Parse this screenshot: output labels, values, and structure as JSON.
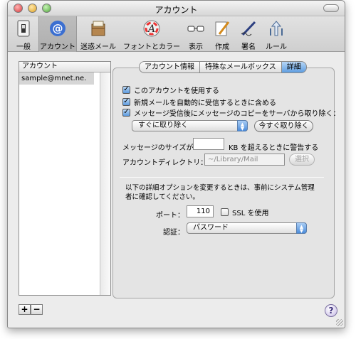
{
  "window": {
    "title": "アカウント"
  },
  "toolbar": {
    "items": [
      {
        "label": "一般",
        "icon": "light-switch-icon"
      },
      {
        "label": "アカウント",
        "icon": "at-sign-icon"
      },
      {
        "label": "迷惑メール",
        "icon": "junk-mail-icon"
      },
      {
        "label": "フォントとカラー",
        "icon": "font-color-icon"
      },
      {
        "label": "表示",
        "icon": "glasses-icon"
      },
      {
        "label": "作成",
        "icon": "compose-pencil-icon"
      },
      {
        "label": "署名",
        "icon": "signature-pen-icon"
      },
      {
        "label": "ルール",
        "icon": "rules-arrows-icon"
      }
    ]
  },
  "sidebar": {
    "header": "アカウント",
    "accounts": [
      "sample@mnet.ne."
    ]
  },
  "buttons": {
    "add": "+",
    "remove": "−",
    "help": "?"
  },
  "tabs": [
    "アカウント情報",
    "特殊なメールボックス",
    "詳細"
  ],
  "advanced": {
    "checkbox_use_account": "このアカウントを使用する",
    "checkbox_auto_receive": "新規メールを自動的に受信するときに含める",
    "checkbox_remove_copy": "メッセージ受信後にメッセージのコピーをサーバから取り除く：",
    "remove_popup_value": "すぐに取り除く",
    "remove_now_button": "今すぐ取り除く",
    "size_label": "メッセージのサイズが",
    "size_value": "",
    "size_suffix": "KB を超えるときに警告する",
    "account_dir_label": "アカウントディレクトリ：",
    "account_dir_value": "~/Library/Mail",
    "select_button": "選択",
    "admin_note": "以下の詳細オプションを変更するときは、事前にシステム管理者に確認してください。",
    "port_label": "ポート：",
    "port_value": "110",
    "ssl_label": "SSL を使用",
    "auth_label": "認証：",
    "auth_value": "パスワード"
  },
  "colors": {
    "accent": "#5b99de",
    "window_bg": "#ececec"
  }
}
